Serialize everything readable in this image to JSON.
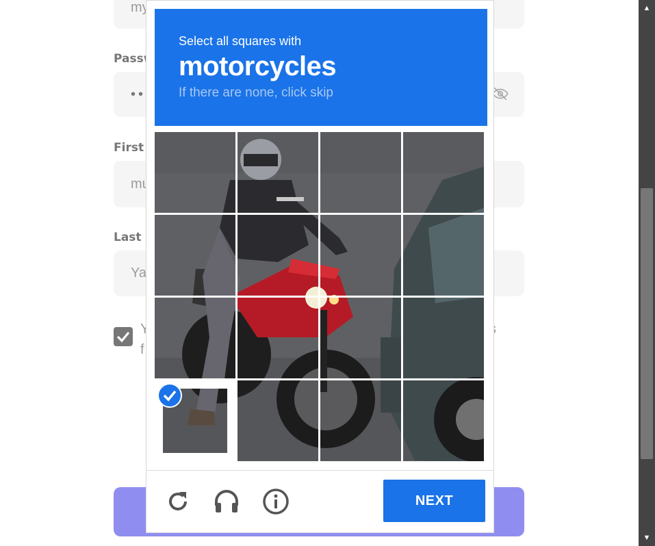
{
  "form": {
    "username_value": "my",
    "password_label": "Passw",
    "password_value": "••",
    "first_name_label": "First n",
    "first_name_value": "mu",
    "last_name_label": "Last n",
    "last_name_value": "Ya",
    "consent_line1_start": "Y",
    "consent_line1_end": "s",
    "consent_line2_start": "f",
    "consent_checked": true
  },
  "captcha": {
    "instruction": "Select all squares with",
    "keyword": "motorcycles",
    "hint": "If there are none, click skip",
    "next_label": "NEXT",
    "grid_size": 4,
    "selected_tiles": [
      12
    ],
    "header_color": "#1a73e8",
    "icons": [
      "reload-icon",
      "audio-icon",
      "info-icon"
    ]
  },
  "colors": {
    "accent": "#1a73e8",
    "submit_bg": "#8f8ef0"
  }
}
